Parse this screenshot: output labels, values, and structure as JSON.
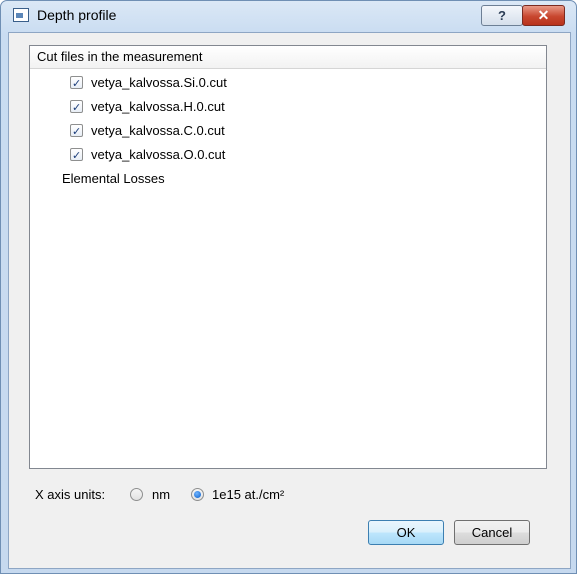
{
  "window": {
    "title": "Depth profile",
    "help_label": "?",
    "close_label": "✕"
  },
  "tree": {
    "header": "Cut files in the measurement",
    "items": [
      {
        "label": "vetya_kalvossa.Si.0.cut",
        "checked": true
      },
      {
        "label": "vetya_kalvossa.H.0.cut",
        "checked": true
      },
      {
        "label": "vetya_kalvossa.C.0.cut",
        "checked": true
      },
      {
        "label": "vetya_kalvossa.O.0.cut",
        "checked": true
      },
      {
        "label": "Elemental Losses",
        "checked": null
      }
    ]
  },
  "x_axis_units": {
    "label": "X axis units:",
    "options": [
      {
        "label": "nm",
        "selected": false
      },
      {
        "label": "1e15 at./cm²",
        "selected": true
      }
    ]
  },
  "buttons": {
    "ok": "OK",
    "cancel": "Cancel"
  },
  "colors": {
    "frame": "#c6d9ef",
    "close_button": "#c8472f",
    "client_bg": "#f0f0f0",
    "default_button": "#bee6fd"
  }
}
